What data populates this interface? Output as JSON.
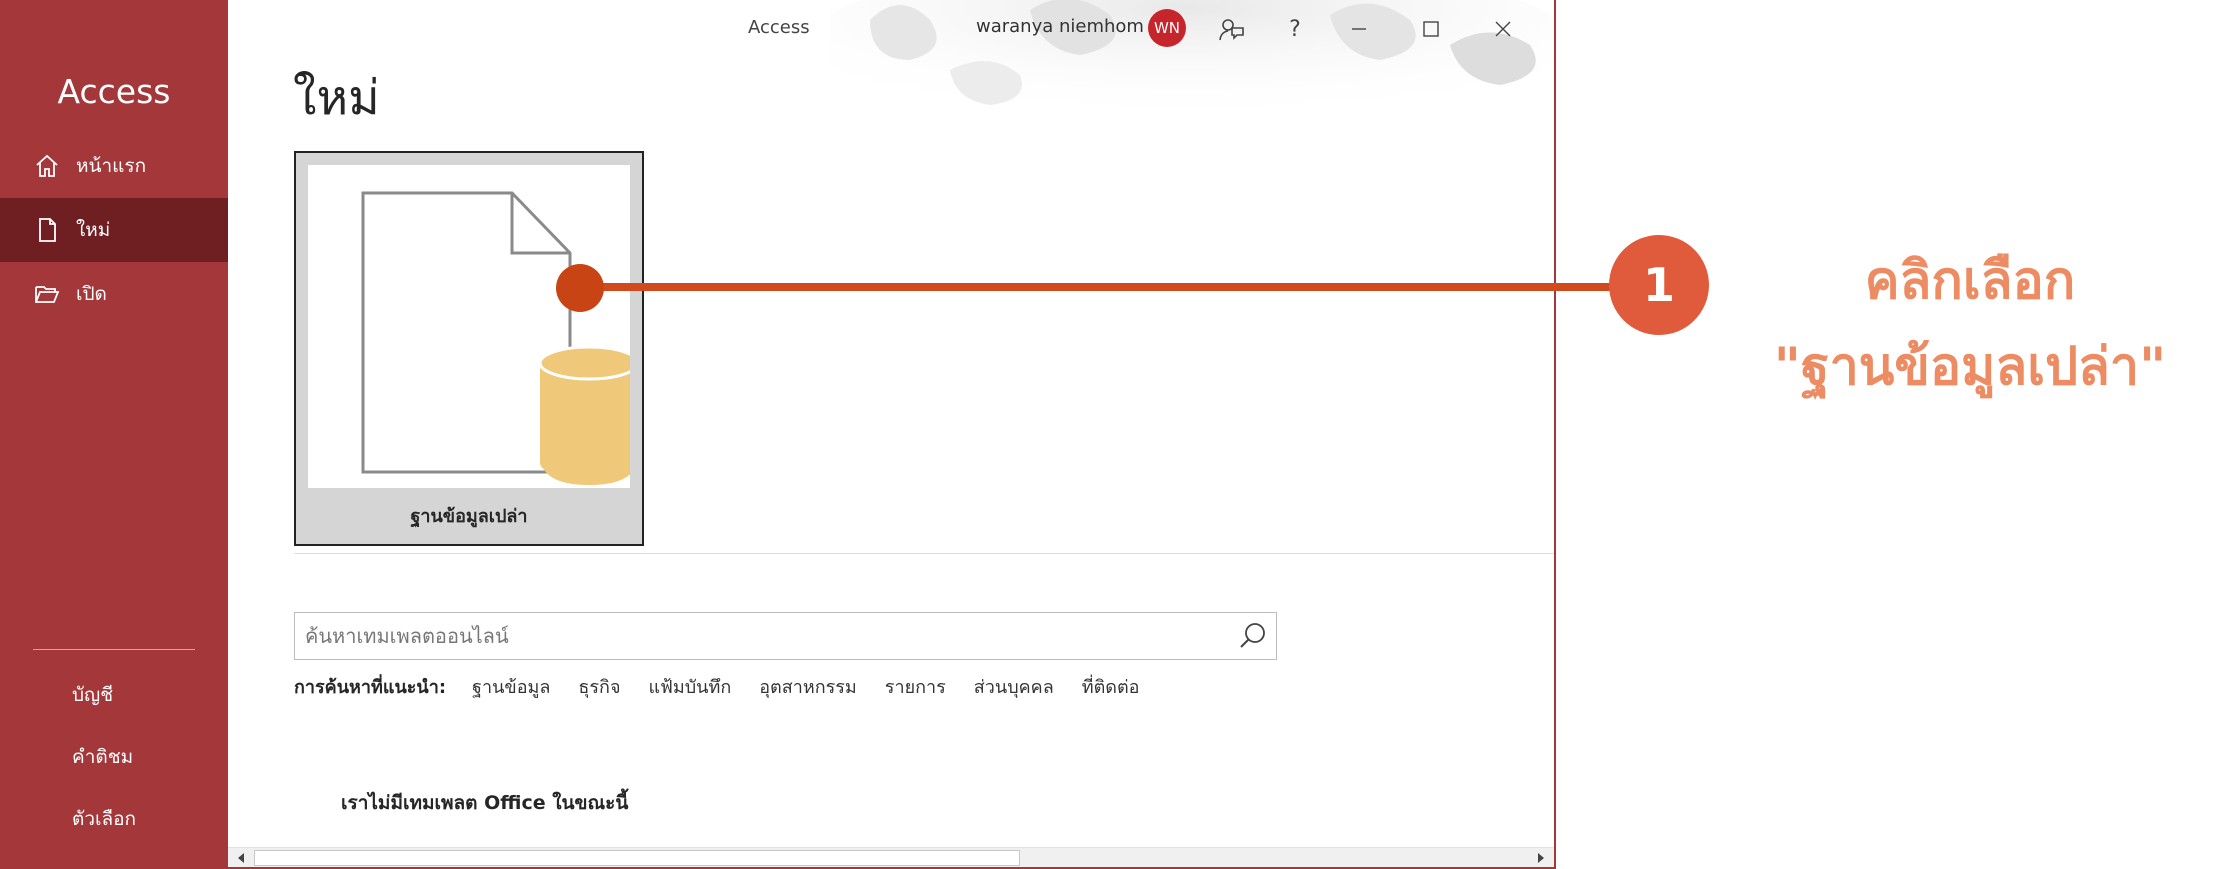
{
  "app": {
    "title": "Access"
  },
  "titlebar": {
    "user_name": "waranya niemhom",
    "avatar_initials": "WN",
    "help": "?"
  },
  "sidebar": {
    "title": "Access",
    "items": [
      {
        "label": "หน้าแรก",
        "icon": "home-icon"
      },
      {
        "label": "ใหม่",
        "icon": "new-document-icon",
        "active": true
      },
      {
        "label": "เปิด",
        "icon": "open-folder-icon"
      }
    ],
    "bottom_items": [
      {
        "label": "บัญชี"
      },
      {
        "label": "คำติชม"
      },
      {
        "label": "ตัวเลือก"
      }
    ]
  },
  "main": {
    "page_title": "ใหม่",
    "template": {
      "label": "ฐานข้อมูลเปล่า"
    },
    "search": {
      "placeholder": "ค้นหาเทมเพลตออนไลน์"
    },
    "suggested": {
      "label": "การค้นหาที่แนะนำ:",
      "links": [
        "ฐานข้อมูล",
        "ธุรกิจ",
        "แฟ้มบันทึก",
        "อุตสาหกรรม",
        "รายการ",
        "ส่วนบุคคล",
        "ที่ติดต่อ"
      ]
    },
    "no_templates_message": "เราไม่มีเทมเพลต Office ในขณะนี้"
  },
  "annotation": {
    "step": "1",
    "line1": "คลิกเลือก",
    "line2": "\"ฐานข้อมูลเปล่า\""
  },
  "colors": {
    "sidebar": "#a4373a",
    "sidebar_active": "#6f1f22",
    "annotation_line": "#d04a1c",
    "annotation_badge": "#e05a3c",
    "annotation_text": "#ed8b62",
    "db_cylinder": "#f0c87a"
  }
}
